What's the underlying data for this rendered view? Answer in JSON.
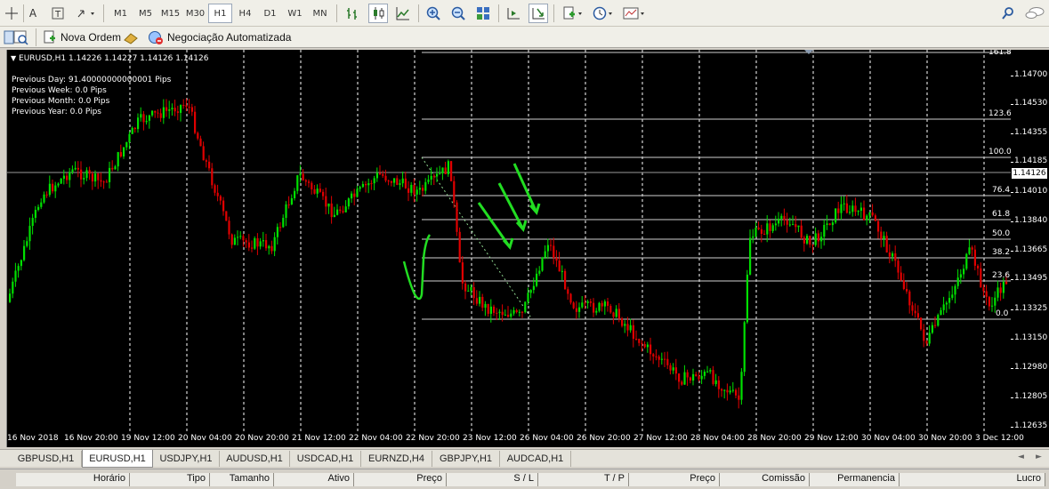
{
  "toolbar": {
    "font_label": "A",
    "timeframes": [
      "M1",
      "M5",
      "M15",
      "M30",
      "H1",
      "H4",
      "D1",
      "W1",
      "MN"
    ],
    "selected_timeframe": "H1"
  },
  "toolbar2": {
    "new_order": "Nova Ordem",
    "auto_trading": "Negociação Automatizada"
  },
  "chart": {
    "header": "EURUSD,H1  1.14226 1.14227 1.14126 1.14126",
    "info_lines": [
      "Previous Day: 91.40000000000001 Pips",
      "Previous Week: 0.0 Pips",
      "Previous Month: 0.0 Pips",
      "Previous Year: 0.0 Pips"
    ],
    "current_price": "1.14126",
    "price_ticks": [
      "1.14700",
      "1.14530",
      "1.14355",
      "1.14185",
      "1.14010",
      "1.13840",
      "1.13665",
      "1.13495",
      "1.13325",
      "1.13150",
      "1.12980",
      "1.12805",
      "1.12635"
    ],
    "time_ticks": [
      "16 Nov 2018",
      "16 Nov 20:00",
      "19 Nov 12:00",
      "20 Nov 04:00",
      "20 Nov 20:00",
      "21 Nov 12:00",
      "22 Nov 04:00",
      "22 Nov 20:00",
      "23 Nov 12:00",
      "26 Nov 04:00",
      "26 Nov 20:00",
      "27 Nov 12:00",
      "28 Nov 04:00",
      "28 Nov 20:00",
      "29 Nov 12:00",
      "30 Nov 04:00",
      "30 Nov 20:00",
      "3 Dec 12:00"
    ],
    "fib_levels": [
      "161.8",
      "123.6",
      "100.0",
      "76.4",
      "61.8",
      "50.0",
      "38.2",
      "23.6",
      "0.0"
    ],
    "colors": {
      "bull": "#00e000",
      "bear": "#e00000",
      "annotation": "#22dd22",
      "background": "#000000"
    }
  },
  "symbol_tabs": [
    "GBPUSD,H1",
    "EURUSD,H1",
    "USDJPY,H1",
    "AUDUSD,H1",
    "USDCAD,H1",
    "EURNZD,H4",
    "GBPJPY,H1",
    "AUDCAD,H1"
  ],
  "active_tab": "EURUSD,H1",
  "terminal_columns": [
    "Horário",
    "Tipo",
    "Tamanho",
    "Ativo",
    "Preço",
    "S / L",
    "T / P",
    "Preço",
    "Comissão",
    "Permanencia",
    "Lucro"
  ]
}
